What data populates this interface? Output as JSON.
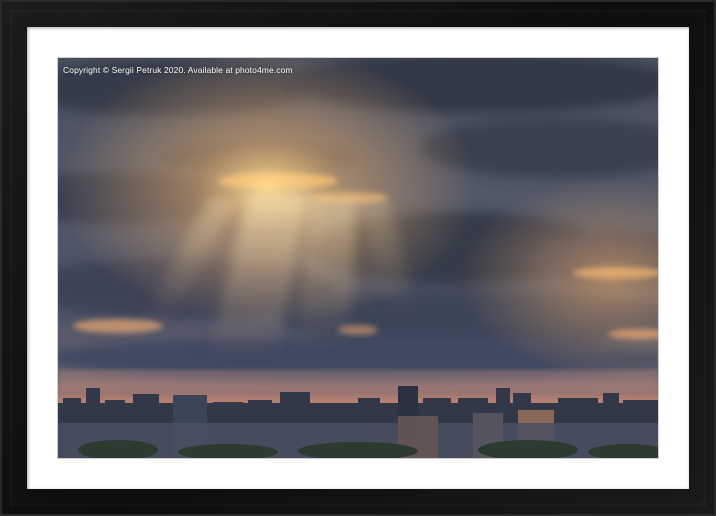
{
  "image": {
    "subject": "framed-print",
    "photo_caption": "Copyright © Sergii Petruk 2020. Available at photo4me.com"
  },
  "colors": {
    "frame": "#141414",
    "mount": "#ffffff",
    "sky_dark": "#3a4150",
    "sky_mid": "#5a5f6e",
    "sunlight": "#f3c278",
    "horizon_glow": "#c98a6a",
    "city": "#2b2f3a"
  }
}
